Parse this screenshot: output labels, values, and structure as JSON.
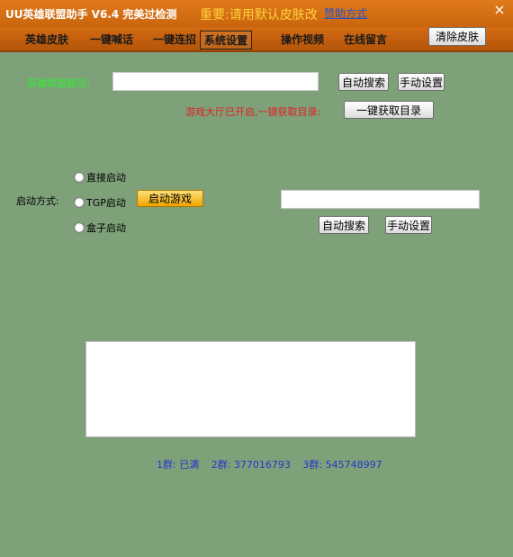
{
  "window": {
    "title": "UU英雄联盟助手 V6.4 完美过检测",
    "notice": "重要:请用默认皮肤改",
    "donate_label": "赞助方式",
    "close_glyph": "×"
  },
  "menu": {
    "items": [
      {
        "label": "英雄皮肤"
      },
      {
        "label": "一键喊话"
      },
      {
        "label": "一键连招"
      },
      {
        "label": "系统设置",
        "active": true
      },
      {
        "label": "操作视频"
      },
      {
        "label": "在线留言"
      }
    ],
    "clear_skin_label": "清除皮肤"
  },
  "lobby": {
    "path_label": "英雄联盟路径：",
    "path_value": "",
    "auto_search_label": "自动搜索",
    "manual_set_label": "手动设置",
    "status_text": "游戏大厅已开启,一键获取目录:",
    "get_dir_label": "一键获取目录"
  },
  "launch": {
    "mode_label": "启动方式:",
    "options": [
      {
        "label": "直接启动"
      },
      {
        "label": "TGP启动"
      },
      {
        "label": "盒子启动"
      }
    ],
    "start_game_label": "启动游戏",
    "path_value": "",
    "auto_search_label": "自动搜索",
    "manual_set_label": "手动设置"
  },
  "output": {
    "text": ""
  },
  "groups": {
    "items": [
      {
        "text": "1群: 已满"
      },
      {
        "text": "2群: 377016793"
      },
      {
        "text": "3群: 545748997"
      }
    ]
  },
  "colors": {
    "title_bg": "#d8701a",
    "body_bg": "#7ea17a",
    "notice": "#ffd23a",
    "status_red": "#e02020",
    "groups_blue": "#2437c9"
  }
}
